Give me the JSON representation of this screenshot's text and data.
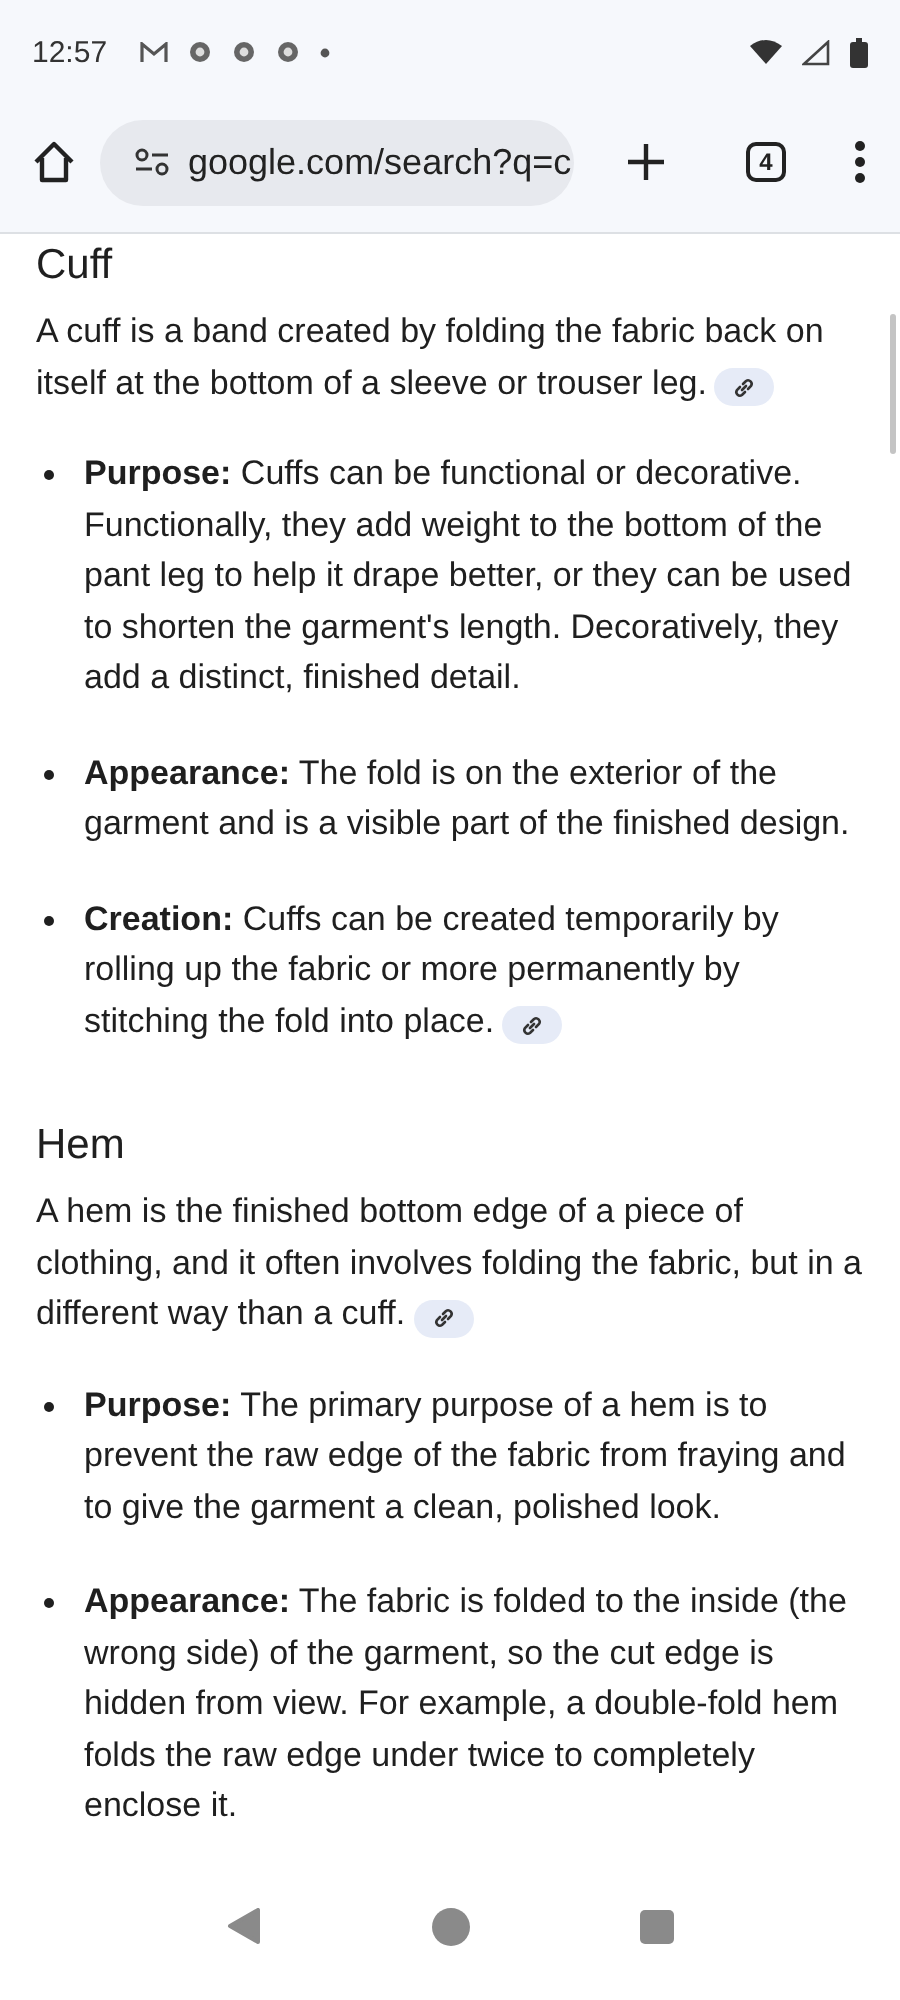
{
  "status_bar": {
    "time": "12:57"
  },
  "toolbar": {
    "url": "google.com/search?q=c",
    "tab_count": "4"
  },
  "sections": [
    {
      "heading": "Cuff",
      "intro": "A cuff is a band created by folding the fabric back on itself at the bottom of a sleeve or trouser leg.",
      "intro_link": true,
      "bullets": [
        {
          "term": "Purpose:",
          "text": "Cuffs can be functional or decorative. Functionally, they add weight to the bottom of the pant leg to help it drape better, or they can be used to shorten the garment's length. Decoratively, they add a distinct, finished detail.",
          "link": false
        },
        {
          "term": "Appearance:",
          "text": "The fold is on the exterior of the garment and is a visible part of the finished design.",
          "link": false
        },
        {
          "term": "Creation:",
          "text": "Cuffs can be created temporarily by rolling up the fabric or more permanently by stitching the fold into place.",
          "link": true
        }
      ]
    },
    {
      "heading": "Hem",
      "intro": "A hem is the finished bottom edge of a piece of clothing, and it often involves folding the fabric, but in a different way than a cuff.",
      "intro_link": true,
      "bullets": [
        {
          "term": "Purpose:",
          "text": "The primary purpose of a hem is to prevent the raw edge of the fabric from fraying and to give the garment a clean, polished look.",
          "link": false
        },
        {
          "term": "Appearance:",
          "text": "The fabric is folded to the inside (the wrong side) of the garment, so the cut edge is hidden from view. For example, a double-fold hem folds the raw edge under twice to completely enclose it.",
          "link": false
        }
      ]
    }
  ]
}
